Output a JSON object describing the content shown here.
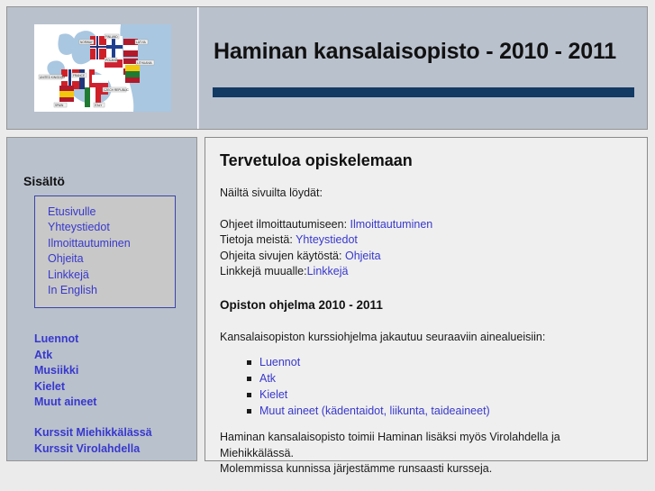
{
  "header": {
    "title": "Haminan kansalaisopisto - 2010 - 2011",
    "logo_alt": "europe-flag-puzzle-map",
    "rule_color": "#123a63",
    "background_color": "#b9c1cd",
    "map_labels": [
      "NORWAY",
      "FINLAND",
      "LATVIA",
      "POLAND",
      "LITHUANIA",
      "UNITED KINGDOM",
      "FRANCE",
      "CZECH REPUBLIC",
      "SPAIN",
      "ITALY"
    ]
  },
  "sidebar": {
    "heading": "Sisältö",
    "nav_box_border_color": "#3b45a8",
    "nav_items": [
      {
        "label": "Etusivulle"
      },
      {
        "label": "Yhteystiedot"
      },
      {
        "label": "Ilmoittautuminen"
      },
      {
        "label": "Ohjeita"
      },
      {
        "label": "Linkkejä"
      },
      {
        "label": "In English"
      }
    ],
    "subject_links": [
      {
        "label": "Luennot"
      },
      {
        "label": "Atk"
      },
      {
        "label": "Musiikki"
      },
      {
        "label": "Kielet"
      },
      {
        "label": "Muut aineet"
      }
    ],
    "location_links": [
      {
        "label": "Kurssit Miehikkälässä"
      },
      {
        "label": "Kurssit Virolahdella"
      }
    ],
    "link_color": "#3838cc"
  },
  "main": {
    "heading": "Tervetuloa opiskelemaan",
    "intro": "Näiltä sivuilta löydät:",
    "info_lines": [
      {
        "text": "Ohjeet ilmoittautumiseen: ",
        "link": "Ilmoittautuminen"
      },
      {
        "text": "Tietoja meistä: ",
        "link": "Yhteystiedot"
      },
      {
        "text": "Ohjeita sivujen käytöstä: ",
        "link": "Ohjeita"
      },
      {
        "text": "Linkkejä muualle:",
        "link": "Linkkejä"
      }
    ],
    "program_heading": "Opiston ohjelma 2010 - 2011",
    "program_intro": "Kansalaisopiston kurssiohjelma jakautuu seuraaviin ainealueisiin:",
    "subjects": [
      {
        "label": "Luennot"
      },
      {
        "label": "Atk"
      },
      {
        "label": "Kielet"
      },
      {
        "label": "Muut aineet (kädentaidot, liikunta, taideaineet)"
      }
    ],
    "footer_line_1": "Haminan kansalaisopisto toimii Haminan lisäksi myös Virolahdella ja",
    "footer_line_2": "Miehikkälässä.",
    "footer_line_3": "Molemmissa kunnissa järjestämme runsaasti kursseja."
  }
}
